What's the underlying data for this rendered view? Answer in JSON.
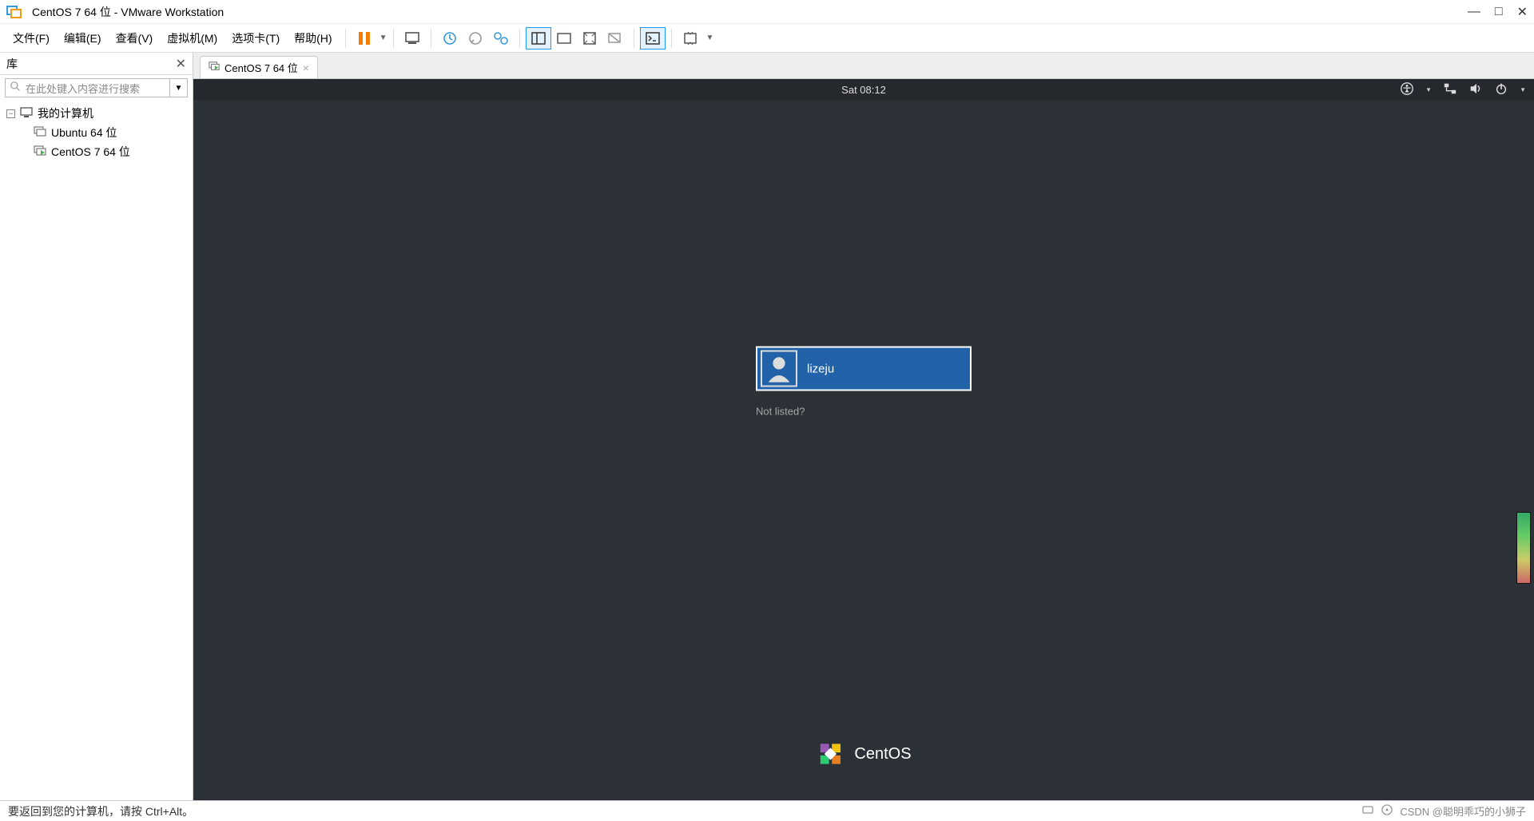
{
  "window": {
    "title": "CentOS 7 64 位 - VMware Workstation",
    "controls": {
      "minimize": "—",
      "maximize": "□",
      "close": "✕"
    }
  },
  "menu": {
    "items": [
      "文件(F)",
      "编辑(E)",
      "查看(V)",
      "虚拟机(M)",
      "选项卡(T)",
      "帮助(H)"
    ]
  },
  "library": {
    "title": "库",
    "close": "✕",
    "search_placeholder": "在此处键入内容进行搜索",
    "root": "我的计算机",
    "vms": [
      "Ubuntu 64 位",
      "CentOS 7 64 位"
    ]
  },
  "tabs": {
    "active": "CentOS 7 64 位"
  },
  "gnome": {
    "clock": "Sat 08:12",
    "login": {
      "user": "lizeju",
      "not_listed": "Not listed?"
    },
    "brand": "CentOS"
  },
  "statusbar": {
    "hint": "要返回到您的计算机，请按 Ctrl+Alt。",
    "watermark": "CSDN @聪明乖巧的小狮子"
  }
}
